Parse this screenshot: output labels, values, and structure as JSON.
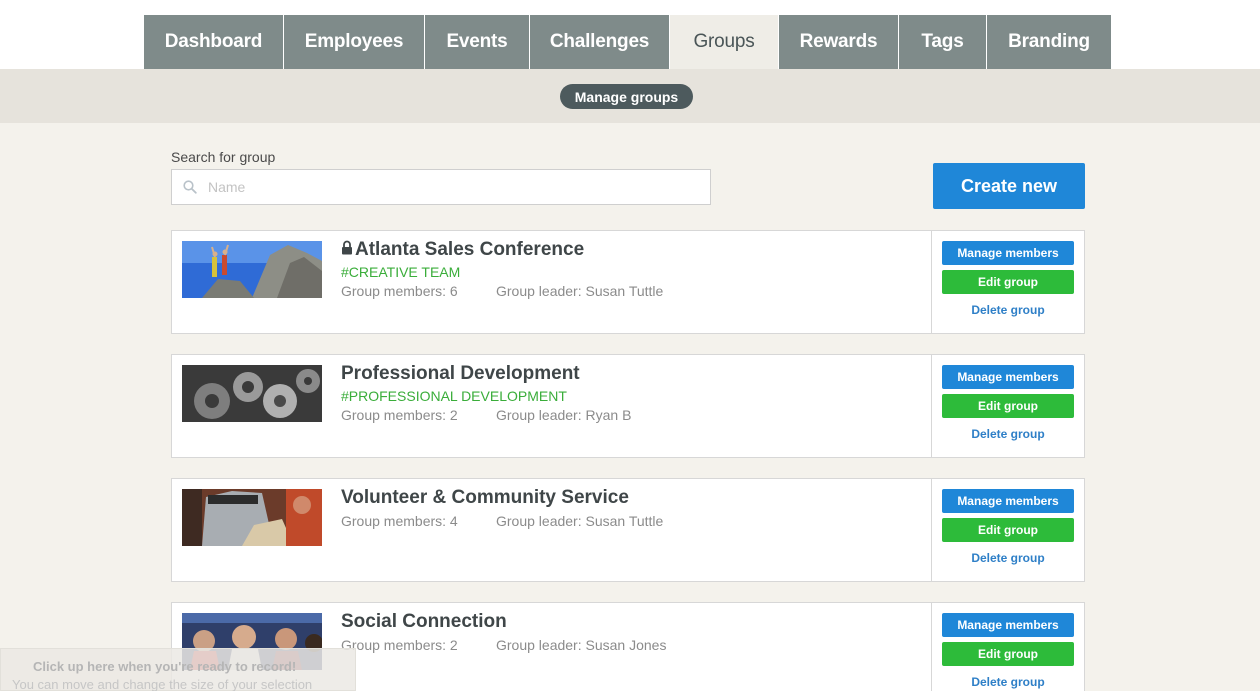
{
  "tabs": [
    {
      "label": "Dashboard",
      "active": false
    },
    {
      "label": "Employees",
      "active": false
    },
    {
      "label": "Events",
      "active": false
    },
    {
      "label": "Challenges",
      "active": false
    },
    {
      "label": "Groups",
      "active": true
    },
    {
      "label": "Rewards",
      "active": false
    },
    {
      "label": "Tags",
      "active": false
    },
    {
      "label": "Branding",
      "active": false
    }
  ],
  "subnav": {
    "label": "Manage groups"
  },
  "search": {
    "label": "Search for group",
    "placeholder": "Name",
    "value": ""
  },
  "create_button": "Create new",
  "groups": [
    {
      "title": "Atlanta Sales Conference",
      "locked": true,
      "tag": "#CREATIVE TEAM",
      "members": "Group members: 6",
      "leader": "Group leader: Susan Tuttle"
    },
    {
      "title": "Professional Development",
      "locked": false,
      "tag": "#PROFESSIONAL DEVELOPMENT",
      "members": "Group members: 2",
      "leader": "Group leader: Ryan B"
    },
    {
      "title": "Volunteer & Community Service",
      "locked": false,
      "tag": "",
      "members": "Group members: 4",
      "leader": "Group leader: Susan Tuttle"
    },
    {
      "title": "Social Connection",
      "locked": false,
      "tag": "",
      "members": "Group members: 2",
      "leader": "Group leader: Susan Jones"
    }
  ],
  "actions": {
    "manage": "Manage members",
    "edit": "Edit group",
    "delete": "Delete group"
  },
  "overlay_hint": {
    "line1": "Click up here when you're ready to record!",
    "line2": "You can move and change the size of your selection"
  },
  "colors": {
    "tab_bg": "#7f8b8a",
    "primary": "#1f87d8",
    "success": "#2dbb3a",
    "tag_green": "#3aad3a"
  }
}
